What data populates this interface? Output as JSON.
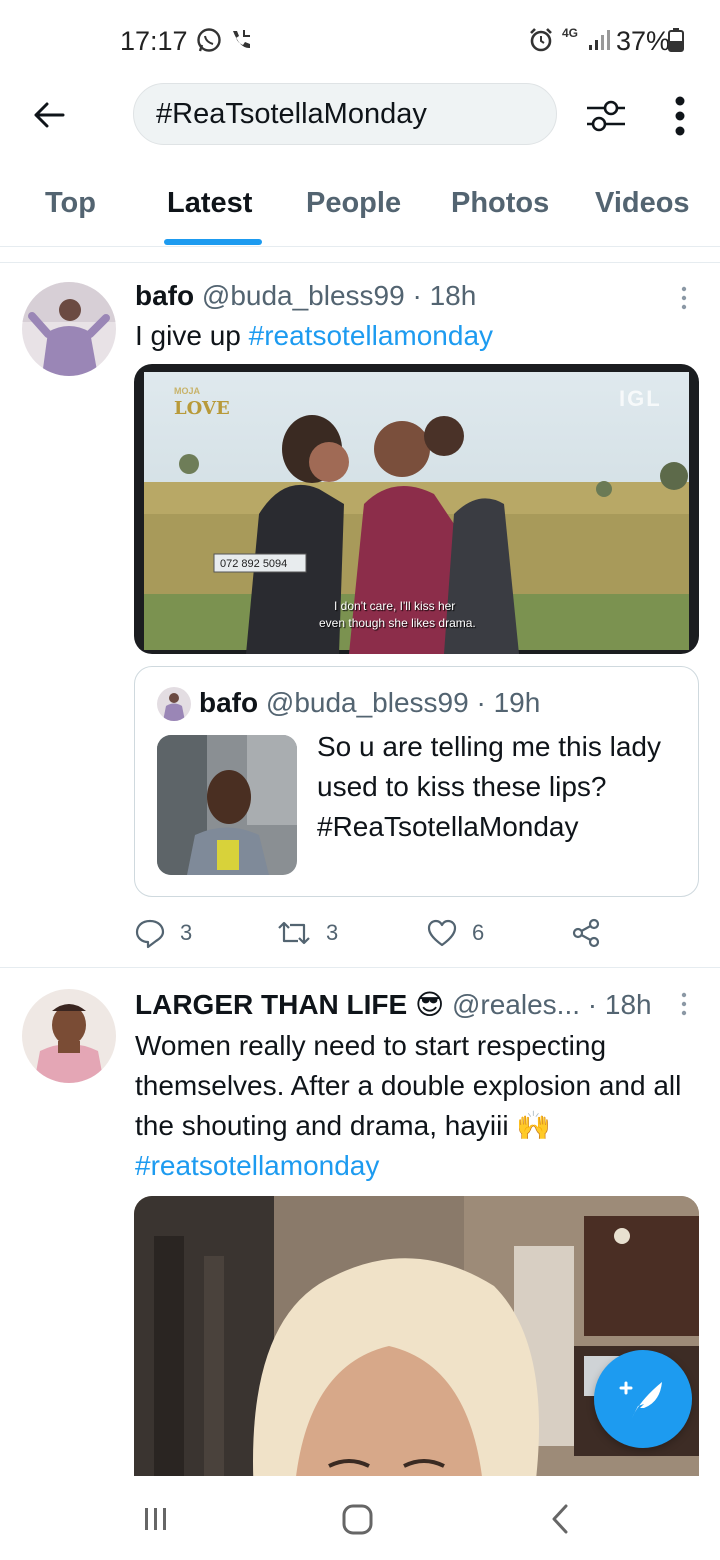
{
  "status_bar": {
    "time": "17:17",
    "battery": "37%",
    "network": "4G",
    "icons": [
      "whatsapp-icon",
      "call-icon",
      "alarm-icon",
      "signal-icon",
      "battery-icon"
    ]
  },
  "search": {
    "query": "#ReaTsotellaMonday"
  },
  "tabs": [
    {
      "label": "Top",
      "active": false
    },
    {
      "label": "Latest",
      "active": true
    },
    {
      "label": "People",
      "active": false
    },
    {
      "label": "Photos",
      "active": false
    },
    {
      "label": "Videos",
      "active": false
    }
  ],
  "tweets": [
    {
      "name": "bafo",
      "handle": "@buda_bless99",
      "time": "· 18h",
      "text": "I give up ",
      "hashtag": "#reatsotellamonday",
      "media": {
        "channel_logo_top": "MOJA",
        "channel_logo_bottom": "LOVE",
        "corner_logo": "IGL",
        "phone": "072 892 5094",
        "subtitle_line1": "I don't care, I'll kiss her",
        "subtitle_line2": "even though she likes drama."
      },
      "quote": {
        "name": "bafo",
        "handle": "@buda_bless99",
        "time": "· 19h",
        "text": "So u are telling me this lady used to kiss these lips?  #ReaTsotellaMonday"
      },
      "replies": "3",
      "retweets": "3",
      "likes": "6"
    },
    {
      "name": "LARGER THAN LIFE",
      "emoji": "😎",
      "handle": "@reales...",
      "time": "· 18h",
      "text": "Women really need to start respecting themselves. After a double explosion and all the shouting and drama, hayiii ",
      "emoji_inline": "🙌",
      "hashtag": "#reatsotellamonday"
    }
  ],
  "colors": {
    "accent": "#1d9bf0",
    "text_primary": "#0f1419",
    "text_secondary": "#536471"
  }
}
